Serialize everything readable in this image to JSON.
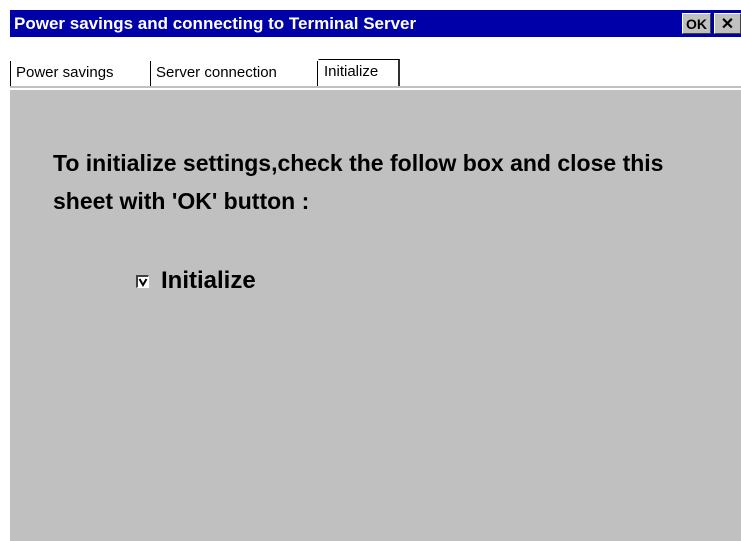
{
  "window": {
    "title": "Power savings and connecting to Terminal Server",
    "ok_label": "OK",
    "close_label": "✕"
  },
  "tabs": [
    {
      "label": "Power savings",
      "selected": false
    },
    {
      "label": "Server connection",
      "selected": false
    },
    {
      "label": "Initialize",
      "selected": true
    }
  ],
  "content": {
    "instructions": "To initialize settings,check the follow box and close this sheet with 'OK' button :",
    "checkbox": {
      "label": "Initialize",
      "checked": true
    }
  },
  "colors": {
    "titlebar": "#0000a8",
    "face": "#c0c0c0",
    "tabstrip": "#ffffff"
  }
}
